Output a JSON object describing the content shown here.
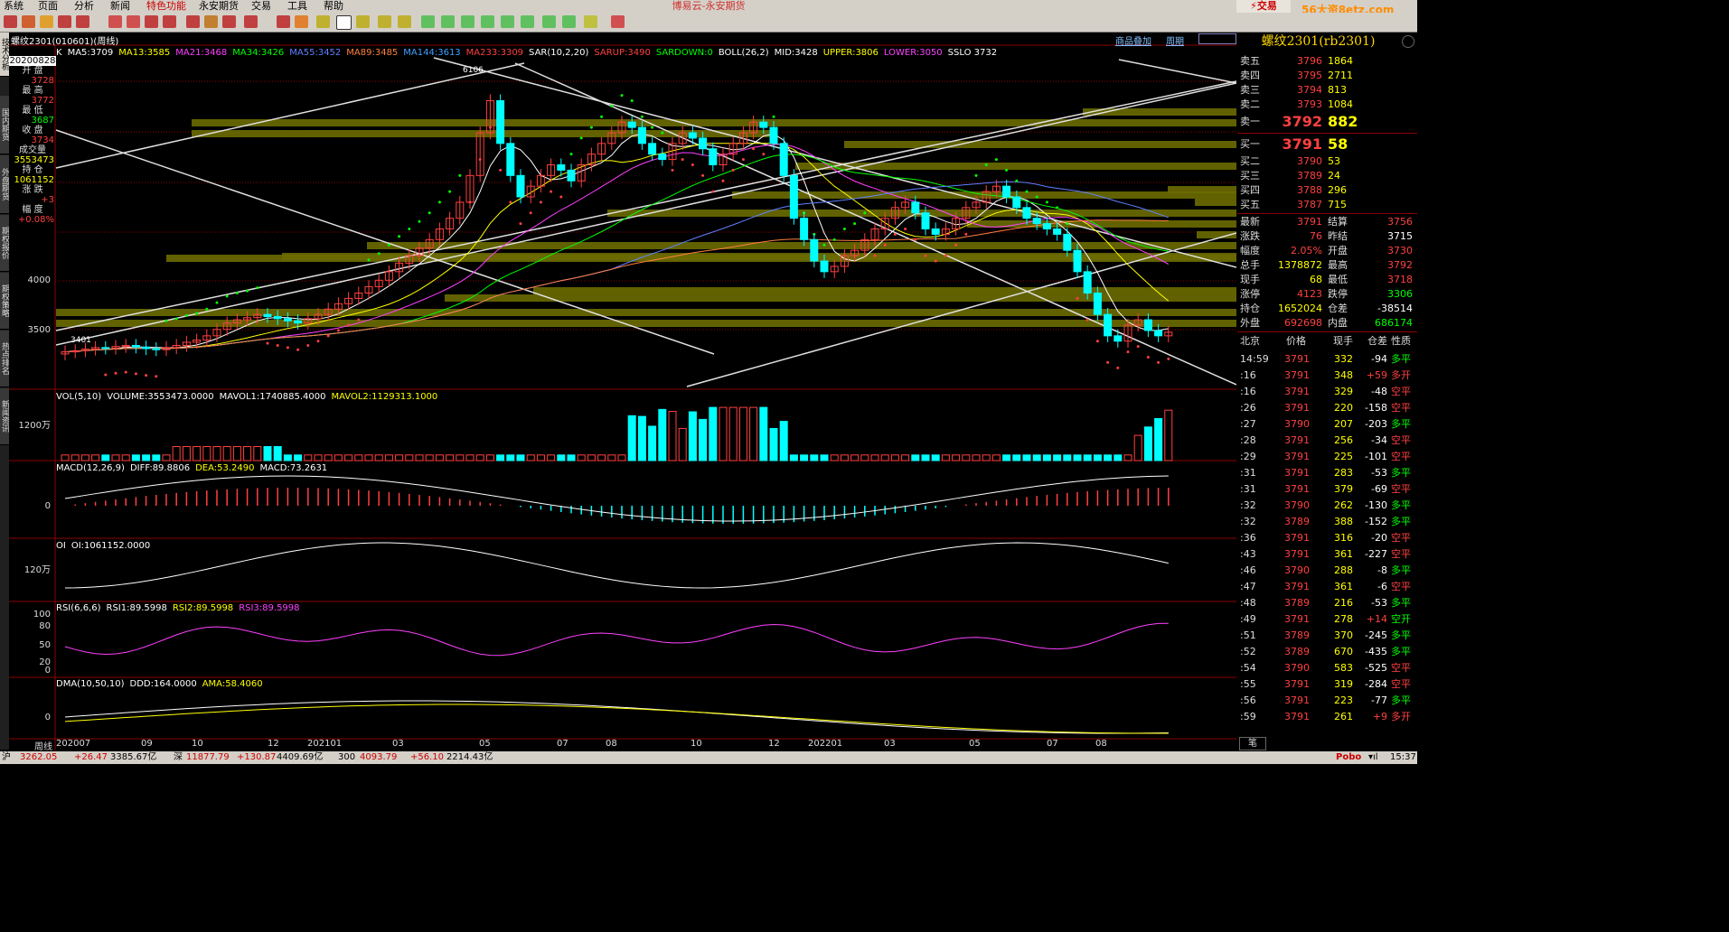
{
  "menu": [
    "系统",
    "页面",
    "分析",
    "新闻",
    "特色功能",
    "永安期货",
    "交易",
    "工具",
    "帮助"
  ],
  "app_title": "博易云-永安期货",
  "trade_button": "交易",
  "watermark": "56大资8etz.com",
  "left_tabs": [
    "技术分析",
    "国内期货",
    "外盘期货",
    "期权报价",
    "期权策略",
    "热点排名",
    "新闻资讯"
  ],
  "chart_header": {
    "title": "螺纹2301(010601)(周线)",
    "links": [
      "商品叠加",
      "周期"
    ]
  },
  "info_panel": [
    {
      "label": "20200828",
      "value": ""
    },
    {
      "label": "开 盘",
      "value": "3728",
      "color": "#ff4040"
    },
    {
      "label": "最 高",
      "value": "3772",
      "color": "#ff4040"
    },
    {
      "label": "最 低",
      "value": "3687",
      "color": "#00ff00"
    },
    {
      "label": "收 盘",
      "value": "3734",
      "color": "#ff4040"
    },
    {
      "label": "成交量",
      "value": "3553473",
      "color": "#ffff00"
    },
    {
      "label": "持 仓",
      "value": "1061152",
      "color": "#ffff00"
    },
    {
      "label": "涨 跌",
      "value": "+3",
      "color": "#ff4040"
    },
    {
      "label": "幅 度",
      "value": "+0.08%",
      "color": "#ff4040"
    }
  ],
  "main_indicators": [
    {
      "text": "K",
      "color": "#ffffff"
    },
    {
      "text": "MA5:3709",
      "color": "#ffffff"
    },
    {
      "text": "MA13:3585",
      "color": "#ffff00"
    },
    {
      "text": "MA21:3468",
      "color": "#ff40ff"
    },
    {
      "text": "MA34:3426",
      "color": "#00ff00"
    },
    {
      "text": "MA55:3452",
      "color": "#6080ff"
    },
    {
      "text": "MA89:3485",
      "color": "#ff8040"
    },
    {
      "text": "MA144:3613",
      "color": "#40a0ff"
    },
    {
      "text": "MA233:3309",
      "color": "#ff4040"
    },
    {
      "text": "SAR(10,2,20)",
      "color": "#ffffff"
    },
    {
      "text": "SARUP:3490",
      "color": "#ff4040"
    },
    {
      "text": "SARDOWN:0",
      "color": "#00ff00"
    },
    {
      "text": "BOLL(26,2)",
      "color": "#ffffff"
    },
    {
      "text": "MID:3428",
      "color": "#ffffff"
    },
    {
      "text": "UPPER:3806",
      "color": "#ffff00"
    },
    {
      "text": "LOWER:3050",
      "color": "#ff40ff"
    },
    {
      "text": "SSLO 3732",
      "color": "#ffffff"
    }
  ],
  "main_axis": [
    "4000",
    "3500"
  ],
  "annotations": [
    "6106",
    "3401"
  ],
  "vol_indicators": [
    {
      "text": "VOL(5,10)",
      "color": "#ffffff"
    },
    {
      "text": "VOLUME:3553473.0000",
      "color": "#ffffff"
    },
    {
      "text": "MAVOL1:1740885.4000",
      "color": "#ffffff"
    },
    {
      "text": "MAVOL2:1129313.1000",
      "color": "#ffff00"
    }
  ],
  "vol_axis": [
    "1200万"
  ],
  "macd_indicators": [
    {
      "text": "MACD(12,26,9)",
      "color": "#ffffff"
    },
    {
      "text": "DIFF:89.8806",
      "color": "#ffffff"
    },
    {
      "text": "DEA:53.2490",
      "color": "#ffff00"
    },
    {
      "text": "MACD:73.2631",
      "color": "#ffffff"
    }
  ],
  "macd_axis": [
    "0"
  ],
  "oi_indicators": [
    {
      "text": "OI",
      "color": "#ffffff"
    },
    {
      "text": "OI:1061152.0000",
      "color": "#ffffff"
    }
  ],
  "oi_axis": [
    "120万"
  ],
  "rsi_indicators": [
    {
      "text": "RSI(6,6,6)",
      "color": "#ffffff"
    },
    {
      "text": "RSI1:89.5998",
      "color": "#ffffff"
    },
    {
      "text": "RSI2:89.5998",
      "color": "#ffff00"
    },
    {
      "text": "RSI3:89.5998",
      "color": "#ff40ff"
    }
  ],
  "rsi_axis": [
    "100",
    "80",
    "50",
    "20",
    "0"
  ],
  "dma_indicators": [
    {
      "text": "DMA(10,50,10)",
      "color": "#ffffff"
    },
    {
      "text": "DDD:164.0000",
      "color": "#ffffff"
    },
    {
      "text": "AMA:58.4060",
      "color": "#ffff00"
    }
  ],
  "dma_axis": [
    "0"
  ],
  "x_axis": {
    "period_label": "周线",
    "ticks": [
      "202007",
      "09",
      "10",
      "12",
      "202101",
      "03",
      "05",
      "07",
      "08",
      "10",
      "12",
      "202201",
      "03",
      "05",
      "07",
      "08"
    ]
  },
  "quote": {
    "title": "螺纹2301(rb2301)",
    "asks": [
      {
        "name": "卖五",
        "price": "3796",
        "vol": "1864"
      },
      {
        "name": "卖四",
        "price": "3795",
        "vol": "2711"
      },
      {
        "name": "卖三",
        "price": "3794",
        "vol": "813"
      },
      {
        "name": "卖二",
        "price": "3793",
        "vol": "1084"
      },
      {
        "name": "卖一",
        "price": "3792",
        "vol": "882"
      }
    ],
    "bids": [
      {
        "name": "买一",
        "price": "3791",
        "vol": "58"
      },
      {
        "name": "买二",
        "price": "3790",
        "vol": "53"
      },
      {
        "name": "买三",
        "price": "3789",
        "vol": "24"
      },
      {
        "name": "买四",
        "price": "3788",
        "vol": "296"
      },
      {
        "name": "买五",
        "price": "3787",
        "vol": "715"
      }
    ],
    "stats": [
      {
        "l1": "最新",
        "v1": "3791",
        "c1": "#ff4040",
        "l2": "结算",
        "v2": "3756",
        "c2": "#ff4040"
      },
      {
        "l1": "涨跌",
        "v1": "76",
        "c1": "#ff4040",
        "l2": "昨结",
        "v2": "3715",
        "c2": "#ffffff"
      },
      {
        "l1": "幅度",
        "v1": "2.05%",
        "c1": "#ff4040",
        "l2": "开盘",
        "v2": "3730",
        "c2": "#ff4040"
      },
      {
        "l1": "总手",
        "v1": "1378872",
        "c1": "#ffff00",
        "l2": "最高",
        "v2": "3792",
        "c2": "#ff4040"
      },
      {
        "l1": "现手",
        "v1": "68",
        "c1": "#ffff00",
        "l2": "最低",
        "v2": "3718",
        "c2": "#ff4040"
      },
      {
        "l1": "涨停",
        "v1": "4123",
        "c1": "#ff4040",
        "l2": "跌停",
        "v2": "3306",
        "c2": "#00ff00"
      },
      {
        "l1": "持仓",
        "v1": "1652024",
        "c1": "#ffff00",
        "l2": "仓差",
        "v2": "-38514",
        "c2": "#ffffff"
      },
      {
        "l1": "外盘",
        "v1": "692698",
        "c1": "#ff4040",
        "l2": "内盘",
        "v2": "686174",
        "c2": "#00ff00"
      }
    ],
    "tick_header": [
      "北京",
      "价格",
      "现手",
      "仓差",
      "性质"
    ],
    "ticks": [
      {
        "t": "14:59",
        "p": "3791",
        "v": "332",
        "c": "-94",
        "k": "多平",
        "pc": "#ff4040",
        "cc": "#ffffff",
        "kc": "#00ff00"
      },
      {
        "t": ":16",
        "p": "3791",
        "v": "348",
        "c": "+59",
        "k": "多开",
        "pc": "#ff4040",
        "cc": "#ff4040",
        "kc": "#ff4040"
      },
      {
        "t": ":16",
        "p": "3791",
        "v": "329",
        "c": "-48",
        "k": "空平",
        "pc": "#ff4040",
        "cc": "#ffffff",
        "kc": "#ff4040"
      },
      {
        "t": ":26",
        "p": "3791",
        "v": "220",
        "c": "-158",
        "k": "空平",
        "pc": "#ff4040",
        "cc": "#ffffff",
        "kc": "#ff4040"
      },
      {
        "t": ":27",
        "p": "3790",
        "v": "207",
        "c": "-203",
        "k": "多平",
        "pc": "#ff4040",
        "cc": "#ffffff",
        "kc": "#00ff00"
      },
      {
        "t": ":28",
        "p": "3791",
        "v": "256",
        "c": "-34",
        "k": "空平",
        "pc": "#ff4040",
        "cc": "#ffffff",
        "kc": "#ff4040"
      },
      {
        "t": ":29",
        "p": "3791",
        "v": "225",
        "c": "-101",
        "k": "空平",
        "pc": "#ff4040",
        "cc": "#ffffff",
        "kc": "#ff4040"
      },
      {
        "t": ":31",
        "p": "3791",
        "v": "283",
        "c": "-53",
        "k": "多平",
        "pc": "#ff4040",
        "cc": "#ffffff",
        "kc": "#00ff00"
      },
      {
        "t": ":31",
        "p": "3791",
        "v": "379",
        "c": "-69",
        "k": "空平",
        "pc": "#ff4040",
        "cc": "#ffffff",
        "kc": "#ff4040"
      },
      {
        "t": ":32",
        "p": "3790",
        "v": "262",
        "c": "-130",
        "k": "多平",
        "pc": "#ff4040",
        "cc": "#ffffff",
        "kc": "#00ff00"
      },
      {
        "t": ":32",
        "p": "3789",
        "v": "388",
        "c": "-152",
        "k": "多平",
        "pc": "#ff4040",
        "cc": "#ffffff",
        "kc": "#00ff00"
      },
      {
        "t": ":36",
        "p": "3791",
        "v": "316",
        "c": "-20",
        "k": "空平",
        "pc": "#ff4040",
        "cc": "#ffffff",
        "kc": "#ff4040"
      },
      {
        "t": ":43",
        "p": "3791",
        "v": "361",
        "c": "-227",
        "k": "空平",
        "pc": "#ff4040",
        "cc": "#ffffff",
        "kc": "#ff4040"
      },
      {
        "t": ":46",
        "p": "3790",
        "v": "288",
        "c": "-8",
        "k": "多平",
        "pc": "#ff4040",
        "cc": "#ffffff",
        "kc": "#00ff00"
      },
      {
        "t": ":47",
        "p": "3791",
        "v": "361",
        "c": "-6",
        "k": "空平",
        "pc": "#ff4040",
        "cc": "#ffffff",
        "kc": "#ff4040"
      },
      {
        "t": ":48",
        "p": "3789",
        "v": "216",
        "c": "-53",
        "k": "多平",
        "pc": "#ff4040",
        "cc": "#ffffff",
        "kc": "#00ff00"
      },
      {
        "t": ":49",
        "p": "3791",
        "v": "278",
        "c": "+14",
        "k": "空开",
        "pc": "#ff4040",
        "cc": "#ff4040",
        "kc": "#00ff00"
      },
      {
        "t": ":51",
        "p": "3789",
        "v": "370",
        "c": "-245",
        "k": "多平",
        "pc": "#ff4040",
        "cc": "#ffffff",
        "kc": "#00ff00"
      },
      {
        "t": ":52",
        "p": "3789",
        "v": "670",
        "c": "-435",
        "k": "多平",
        "pc": "#ff4040",
        "cc": "#ffffff",
        "kc": "#00ff00"
      },
      {
        "t": ":54",
        "p": "3790",
        "v": "583",
        "c": "-525",
        "k": "空平",
        "pc": "#ff4040",
        "cc": "#ffffff",
        "kc": "#ff4040"
      },
      {
        "t": ":55",
        "p": "3791",
        "v": "319",
        "c": "-284",
        "k": "空平",
        "pc": "#ff4040",
        "cc": "#ffffff",
        "kc": "#ff4040"
      },
      {
        "t": ":56",
        "p": "3791",
        "v": "223",
        "c": "-77",
        "k": "多平",
        "pc": "#ff4040",
        "cc": "#ffffff",
        "kc": "#00ff00"
      },
      {
        "t": ":59",
        "p": "3791",
        "v": "261",
        "c": "+9",
        "k": "多开",
        "pc": "#ff4040",
        "cc": "#ff4040",
        "kc": "#ff4040"
      }
    ],
    "bottom_tab": "笔"
  },
  "status": {
    "sh_label": "沪",
    "sh_price": "3262.05",
    "sh_chg": "+26.47",
    "sh_amt": "3385.67亿",
    "sz_label": "深",
    "sz_price": "11877.79",
    "sz_chg": "+130.87",
    "sz_amt": "4409.69亿",
    "c3_label": "300",
    "c3_price": "4093.79",
    "c3_chg": "+56.10",
    "c3_amt": "2214.43亿",
    "brand": "Pobo",
    "clock": "15:37"
  },
  "colors": {
    "up": "#ff4040",
    "down": "#00ffff",
    "bg": "#000000",
    "grid": "#8b0000",
    "volband": "#6b6b00"
  }
}
